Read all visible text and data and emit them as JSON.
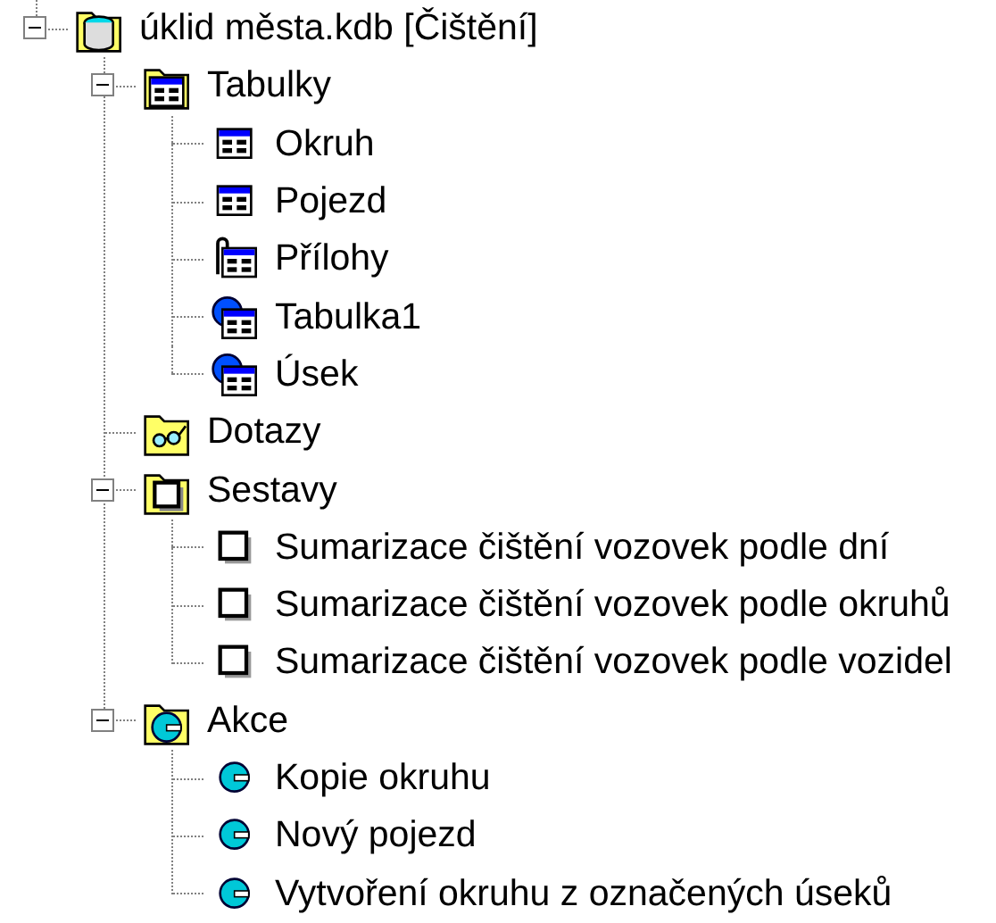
{
  "tree": [
    {
      "label": "úklid města.kdb [Čištění]",
      "kind": "database",
      "expanded": true,
      "children": [
        {
          "label": "Tabulky",
          "kind": "tables",
          "expanded": true,
          "children": [
            {
              "label": "Okruh",
              "kind": "table"
            },
            {
              "label": "Pojezd",
              "kind": "table"
            },
            {
              "label": "Přílohy",
              "kind": "attachments"
            },
            {
              "label": "Tabulka1",
              "kind": "linked"
            },
            {
              "label": "Úsek",
              "kind": "linked"
            }
          ]
        },
        {
          "label": "Dotazy",
          "kind": "queries"
        },
        {
          "label": "Sestavy",
          "kind": "reports",
          "expanded": true,
          "children": [
            {
              "label": "Sumarizace čištění vozovek podle dní",
              "kind": "report"
            },
            {
              "label": "Sumarizace čištění vozovek podle okruhů",
              "kind": "report"
            },
            {
              "label": "Sumarizace čištění vozovek podle vozidel",
              "kind": "report"
            }
          ]
        },
        {
          "label": "Akce",
          "kind": "macros",
          "expanded": true,
          "children": [
            {
              "label": "Kopie okruhu",
              "kind": "macro"
            },
            {
              "label": "Nový pojezd",
              "kind": "macro"
            },
            {
              "label": "Vytvoření okruhu z označených úseků",
              "kind": "macro"
            }
          ]
        }
      ]
    }
  ]
}
